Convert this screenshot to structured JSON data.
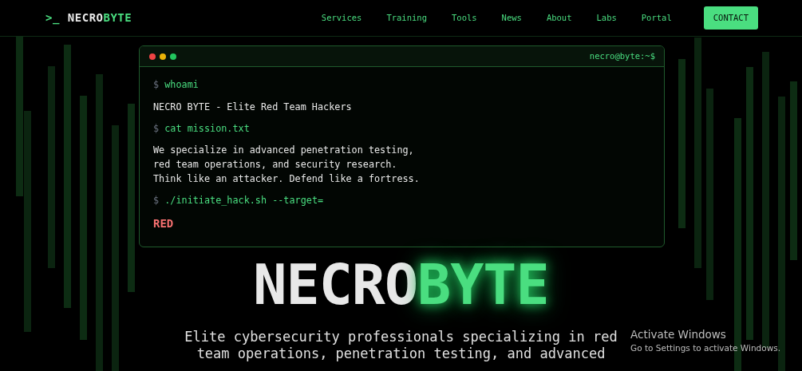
{
  "nav": {
    "logo": {
      "prompt": ">_",
      "first": "NECRO",
      "second": "BYTE"
    },
    "links": [
      "Services",
      "Training",
      "Tools",
      "News",
      "About",
      "Labs",
      "Portal"
    ],
    "contact": "CONTACT"
  },
  "terminal": {
    "title": "necro@byte:~$",
    "lines": [
      {
        "kind": "command",
        "prompt": "$",
        "text": "whoami"
      },
      {
        "kind": "output",
        "text": "NECRO BYTE - Elite Red Team Hackers"
      },
      {
        "kind": "command",
        "prompt": "$",
        "text": "cat mission.txt"
      },
      {
        "kind": "output",
        "text": "We specialize in advanced penetration testing,\nred team operations, and security research.\nThink like an attacker. Defend like a fortress."
      },
      {
        "kind": "command",
        "prompt": "$",
        "text": "./initiate_hack.sh --target="
      },
      {
        "kind": "alert",
        "text": "RED"
      }
    ]
  },
  "hero": {
    "title_main": "NECRO",
    "title_accent": "BYTE",
    "subtitle": "Elite cybersecurity professionals specializing in red team operations, penetration testing, and advanced"
  },
  "os_notice": {
    "title": "Activate Windows",
    "text": "Go to Settings to activate Windows."
  }
}
